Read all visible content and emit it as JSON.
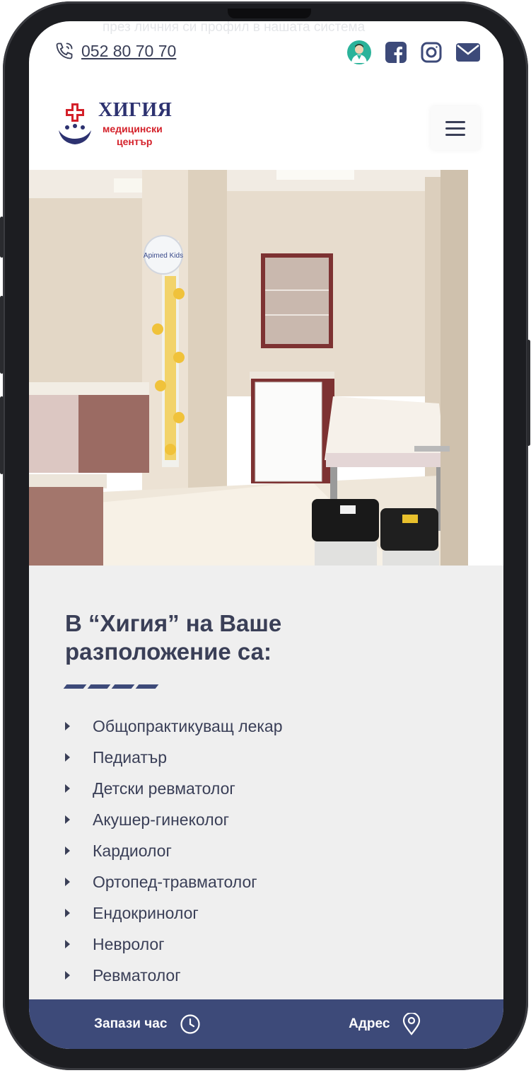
{
  "banner_text": "през личния си профил в нашата система",
  "topbar": {
    "phone_number": "052 80 70 70",
    "icons": [
      "phone-icon",
      "doctor-avatar-icon",
      "facebook-icon",
      "instagram-icon",
      "mail-icon"
    ]
  },
  "logo": {
    "name": "ХИГИЯ",
    "sub1": "медицински",
    "sub2": "център"
  },
  "photo": {
    "sign_text": "Apimed Kids"
  },
  "content": {
    "heading": "В “Хигия” на Ваше разположение са:",
    "specialists": [
      "Общопрактикуващ лекар",
      "Педиатър",
      "Детски ревматолог",
      "Акушер-гинеколог",
      "Кардиолог",
      "Ортопед-травматолог",
      "Ендокринолог",
      "Невролог",
      "Ревматолог"
    ]
  },
  "bottombar": {
    "book_label": "Запази час",
    "address_label": "Адрес"
  },
  "colors": {
    "brand_navy": "#3d4a79",
    "text_dark": "#3a3f57",
    "logo_red": "#d4212a",
    "section_bg": "#efefef"
  }
}
